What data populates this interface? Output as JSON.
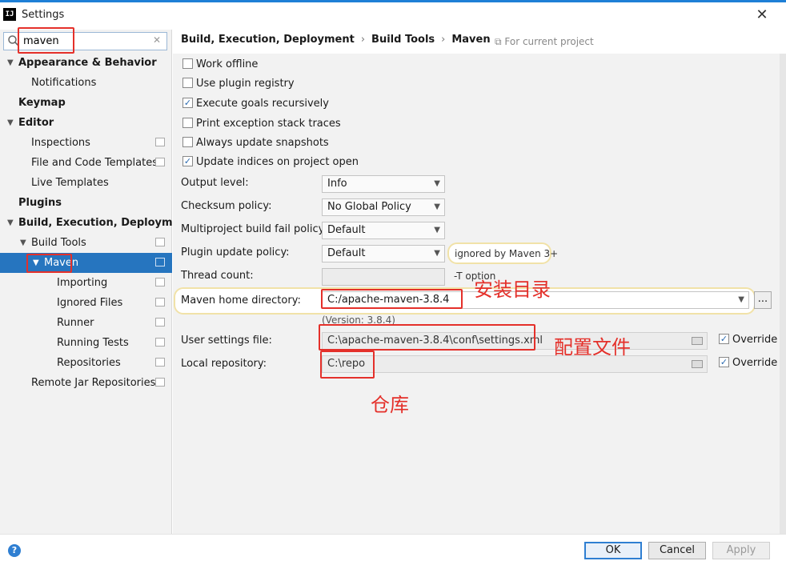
{
  "window": {
    "title": "Settings",
    "app_icon": "IJ",
    "close_glyph": "✕"
  },
  "search": {
    "value": "maven",
    "clear_glyph": "✕"
  },
  "tree": {
    "items": [
      {
        "label": "Appearance & Behavior",
        "expanded": true,
        "bold": true
      },
      {
        "label": "Notifications"
      },
      {
        "label": "Keymap",
        "bold": true
      },
      {
        "label": "Editor",
        "expanded": true,
        "bold": true
      },
      {
        "label": "Inspections"
      },
      {
        "label": "File and Code Templates"
      },
      {
        "label": "Live Templates"
      },
      {
        "label": "Plugins",
        "bold": true
      },
      {
        "label": "Build, Execution, Deployment",
        "expanded": true,
        "bold": true
      },
      {
        "label": "Build Tools",
        "expanded": true
      },
      {
        "label": "Maven",
        "expanded": true,
        "selected": true
      },
      {
        "label": "Importing"
      },
      {
        "label": "Ignored Files"
      },
      {
        "label": "Runner"
      },
      {
        "label": "Running Tests"
      },
      {
        "label": "Repositories"
      },
      {
        "label": "Remote Jar Repositories"
      }
    ]
  },
  "breadcrumb": {
    "part1": "Build, Execution, Deployment",
    "part2": "Build Tools",
    "part3": "Maven",
    "sep": "›",
    "for_project": "For current project"
  },
  "checkboxes": [
    {
      "label": "Work offline",
      "checked": false
    },
    {
      "label": "Use plugin registry",
      "checked": false
    },
    {
      "label": "Execute goals recursively",
      "checked": true
    },
    {
      "label": "Print exception stack traces",
      "checked": false
    },
    {
      "label": "Always update snapshots",
      "checked": false
    },
    {
      "label": "Update indices on project open",
      "checked": true
    }
  ],
  "check_glyph": "✓",
  "form": {
    "output_level": {
      "label": "Output level:",
      "value": "Info"
    },
    "checksum_policy": {
      "label": "Checksum policy:",
      "value": "No Global Policy"
    },
    "multiproject_fail": {
      "label": "Multiproject build fail policy:",
      "value": "Default"
    },
    "plugin_update": {
      "label": "Plugin update policy:",
      "value": "Default",
      "note": "ignored by Maven 3+"
    },
    "thread_count": {
      "label": "Thread count:",
      "value": "",
      "note": "-T option"
    },
    "maven_home": {
      "label": "Maven home directory:",
      "value": "C:/apache-maven-3.8.4",
      "version": "(Version: 3.8.4)",
      "browse": "..."
    },
    "user_settings": {
      "label": "User settings file:",
      "value": "C:\\apache-maven-3.8.4\\conf\\settings.xml",
      "override_label": "Override",
      "override_checked": true
    },
    "local_repo": {
      "label": "Local repository:",
      "value": "C:\\repo",
      "override_label": "Override",
      "override_checked": true
    }
  },
  "annotations": {
    "install_dir": "安装目录",
    "config_file": "配置文件",
    "repository": "仓库",
    "color": "#e4302a"
  },
  "buttons": {
    "ok": "OK",
    "cancel": "Cancel",
    "apply": "Apply",
    "help": "?"
  },
  "colors": {
    "selection": "#2675bf",
    "accent": "#2f7fd2",
    "panel_bg": "#f2f2f2"
  }
}
